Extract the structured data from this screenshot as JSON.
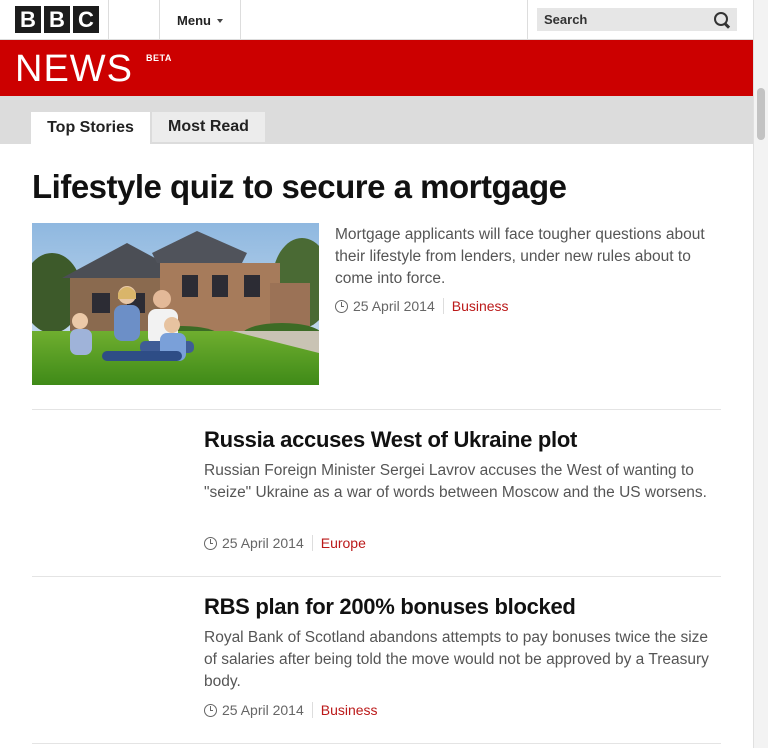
{
  "header": {
    "logo_letters": [
      "B",
      "B",
      "C"
    ],
    "menu_label": "Menu",
    "search_label": "Search",
    "banner_title": "NEWS",
    "banner_badge": "BETA"
  },
  "tabs": [
    {
      "label": "Top Stories",
      "active": true
    },
    {
      "label": "Most Read",
      "active": false
    }
  ],
  "lead_story": {
    "headline": "Lifestyle quiz to secure a mortgage",
    "summary": "Mortgage applicants will face tougher questions about their lifestyle from lenders, under new rules about to come into force.",
    "date": "25 April 2014",
    "section": "Business"
  },
  "stories": [
    {
      "headline": "Russia accuses West of Ukraine plot",
      "summary": "Russian Foreign Minister Sergei Lavrov accuses the West of wanting to \"seize\" Ukraine as a war of words between Moscow and the US worsens.",
      "date": "25 April 2014",
      "section": "Europe"
    },
    {
      "headline": "RBS plan for 200% bonuses blocked",
      "summary": "Royal Bank of Scotland abandons attempts to pay bonuses twice the size of salaries after being told the move would not be approved by a Treasury body.",
      "date": "25 April 2014",
      "section": "Business"
    }
  ],
  "colors": {
    "brand_red": "#cc0000",
    "link_red": "#bb1919",
    "logo_black": "#1c1c1c"
  }
}
